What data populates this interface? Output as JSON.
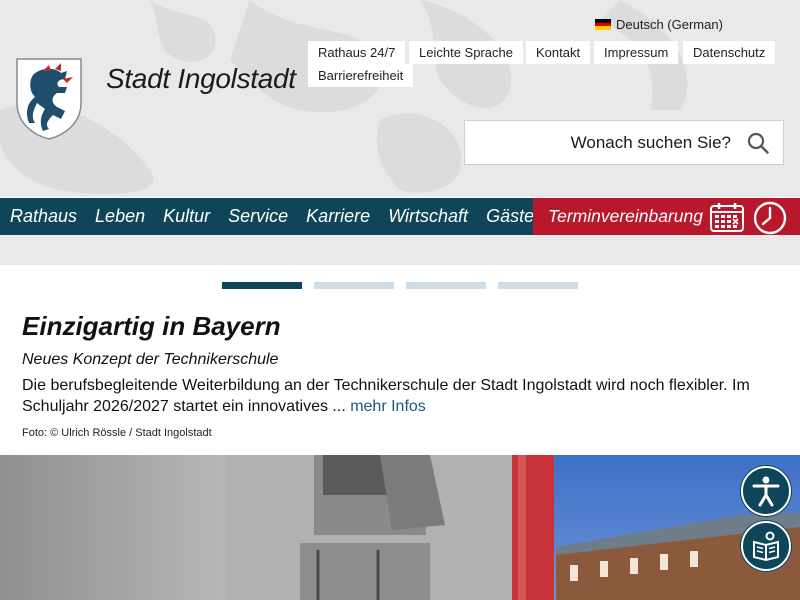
{
  "language": {
    "label": "Deutsch (German)",
    "flag_colors": [
      "#000000",
      "#dd0000",
      "#ffce00"
    ]
  },
  "top_links": [
    {
      "label": "Rathaus 24/7"
    },
    {
      "label": "Leichte Sprache"
    },
    {
      "label": "Kontakt"
    },
    {
      "label": "Impressum"
    },
    {
      "label": "Datenschutz"
    },
    {
      "label": "Barrierefreiheit"
    }
  ],
  "site": {
    "title": "Stadt Ingolstadt"
  },
  "search": {
    "label": "Wonach suchen Sie?"
  },
  "main_nav": {
    "items": [
      {
        "label": "Rathaus"
      },
      {
        "label": "Leben"
      },
      {
        "label": "Kultur"
      },
      {
        "label": "Service"
      },
      {
        "label": "Karriere"
      },
      {
        "label": "Wirtschaft"
      },
      {
        "label": "Gäste"
      }
    ],
    "appointment_label": "Terminvereinbarung"
  },
  "slider": {
    "slide_count": 4,
    "active_index": 0
  },
  "article": {
    "headline": "Einzigartig in Bayern",
    "subheadline": "Neues Konzept der Technikerschule",
    "teaser": "Die berufsbegleitende Weiterbildung an der Technikerschule der Stadt Ingolstadt wird noch flexibler. Im Schuljahr 2026/2027 startet ein innovatives ... ",
    "more_link": "mehr Infos",
    "photo_credit": "Foto: © Ulrich Rössle / Stadt Ingolstadt"
  },
  "colors": {
    "nav_blue": "#0f4559",
    "appointment_red": "#b8182b",
    "link_blue": "#175a83",
    "header_gray": "#e9e9eb"
  },
  "icons": [
    "search-icon",
    "calendar-icon",
    "clock-icon",
    "accessibility-icon",
    "easy-reading-icon"
  ]
}
